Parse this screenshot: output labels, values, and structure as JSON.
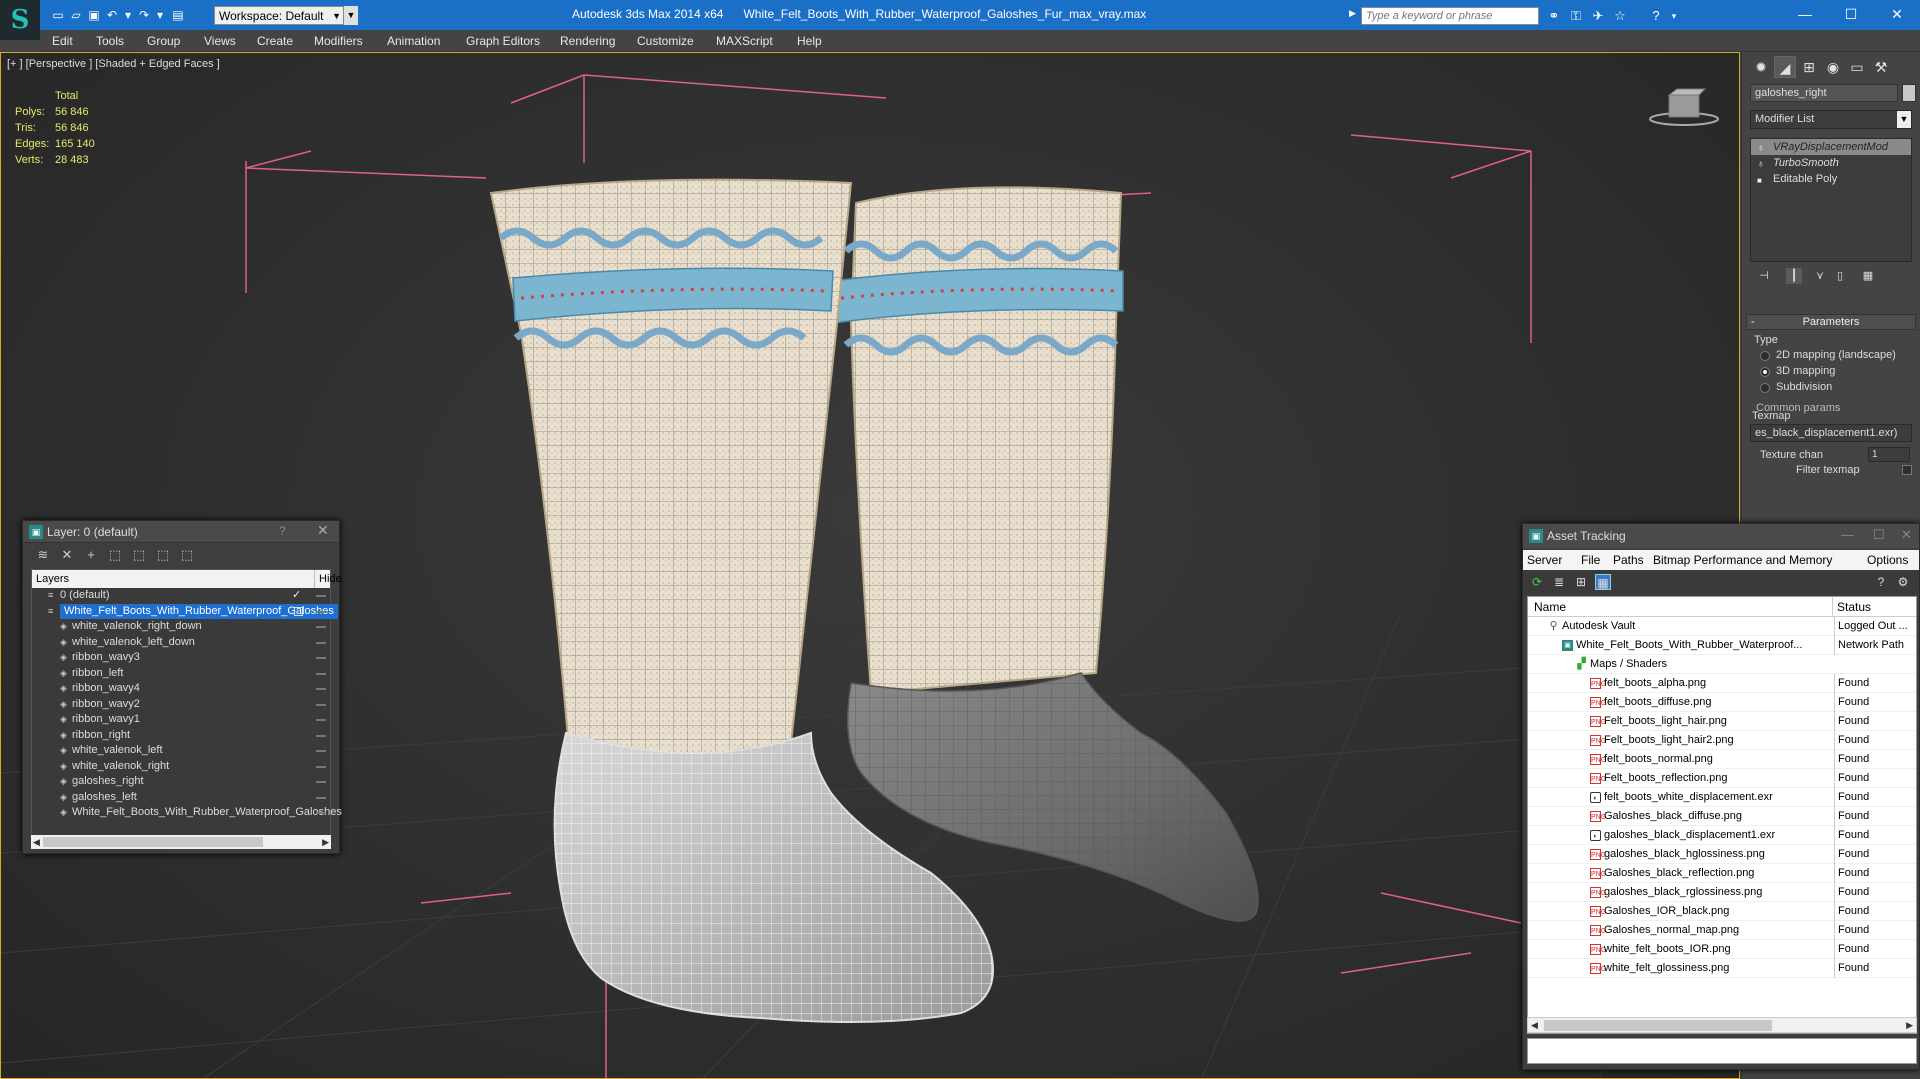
{
  "titlebar": {
    "workspace": "Workspace: Default",
    "app_name": "Autodesk 3ds Max  2014 x64",
    "file_name": "White_Felt_Boots_With_Rubber_Waterproof_Galoshes_Fur_max_vray.max",
    "search_placeholder": "Type a keyword or phrase",
    "accent_color": "#1a6fc7"
  },
  "menu": [
    "Edit",
    "Tools",
    "Group",
    "Views",
    "Create",
    "Modifiers",
    "Animation",
    "Graph Editors",
    "Rendering",
    "Customize",
    "MAXScript",
    "Help"
  ],
  "viewport": {
    "label": "[+ ] [Perspective ] [Shaded + Edged Faces ]",
    "stats": {
      "header": "Total",
      "rows": [
        {
          "k": "Polys:",
          "v": "56 846"
        },
        {
          "k": "Tris:",
          "v": "56 846"
        },
        {
          "k": "Edges:",
          "v": "165 140"
        },
        {
          "k": "Verts:",
          "v": "28 483"
        }
      ]
    },
    "border_color": "#d8a829"
  },
  "command_panel": {
    "object_name": "galoshes_right",
    "modifier_list": "Modifier List",
    "stack": [
      {
        "label": "VRayDisplacementMod",
        "selected": true
      },
      {
        "label": "TurboSmooth",
        "selected": false
      },
      {
        "label": "Editable Poly",
        "selected": false
      }
    ],
    "params_title": "Parameters",
    "type_label": "Type",
    "type_options": [
      "2D mapping (landscape)",
      "3D mapping",
      "Subdivision"
    ],
    "type_selected": 1,
    "common_params": "Common params",
    "texmap_label": "Texmap",
    "texmap_value": "es_black_displacement1.exr)",
    "texture_chan_label": "Texture chan",
    "texture_chan_value": "1",
    "filter_texmap_label": "Filter texmap"
  },
  "layer_explorer": {
    "title": "Layer: 0 (default)",
    "help": "?",
    "col_layers": "Layers",
    "col_hide": "Hide",
    "rows": [
      {
        "label": "0 (default)",
        "indent": 1,
        "type": "layer",
        "checked": true
      },
      {
        "label": "White_Felt_Boots_With_Rubber_Waterproof_Galoshes",
        "indent": 1,
        "type": "layer",
        "selected": true
      },
      {
        "label": "white_valenok_right_down",
        "indent": 2,
        "type": "obj"
      },
      {
        "label": "white_valenok_left_down",
        "indent": 2,
        "type": "obj"
      },
      {
        "label": "ribbon_wavy3",
        "indent": 2,
        "type": "obj"
      },
      {
        "label": "ribbon_left",
        "indent": 2,
        "type": "obj"
      },
      {
        "label": "ribbon_wavy4",
        "indent": 2,
        "type": "obj"
      },
      {
        "label": "ribbon_wavy2",
        "indent": 2,
        "type": "obj"
      },
      {
        "label": "ribbon_wavy1",
        "indent": 2,
        "type": "obj"
      },
      {
        "label": "ribbon_right",
        "indent": 2,
        "type": "obj"
      },
      {
        "label": "white_valenok_left",
        "indent": 2,
        "type": "obj"
      },
      {
        "label": "white_valenok_right",
        "indent": 2,
        "type": "obj"
      },
      {
        "label": "galoshes_right",
        "indent": 2,
        "type": "obj"
      },
      {
        "label": "galoshes_left",
        "indent": 2,
        "type": "obj"
      },
      {
        "label": "White_Felt_Boots_With_Rubber_Waterproof_Galoshes",
        "indent": 2,
        "type": "obj"
      }
    ]
  },
  "asset_tracking": {
    "title": "Asset Tracking",
    "menu": [
      "Server",
      "File",
      "Paths",
      "Bitmap Performance and Memory",
      "Options"
    ],
    "col_name": "Name",
    "col_status": "Status",
    "rows": [
      {
        "name": "Autodesk Vault",
        "status": "Logged Out ...",
        "icon": "vault",
        "indent": 1
      },
      {
        "name": "White_Felt_Boots_With_Rubber_Waterproof...",
        "status": "Network Path",
        "icon": "max",
        "indent": 2
      },
      {
        "name": "Maps / Shaders",
        "status": "",
        "icon": "maps",
        "indent": 3
      },
      {
        "name": "felt_boots_alpha.png",
        "status": "Found",
        "icon": "png",
        "indent": 4
      },
      {
        "name": "felt_boots_diffuse.png",
        "status": "Found",
        "icon": "png",
        "indent": 4
      },
      {
        "name": "Felt_boots_light_hair.png",
        "status": "Found",
        "icon": "png",
        "indent": 4
      },
      {
        "name": "Felt_boots_light_hair2.png",
        "status": "Found",
        "icon": "png",
        "indent": 4
      },
      {
        "name": "felt_boots_normal.png",
        "status": "Found",
        "icon": "png",
        "indent": 4
      },
      {
        "name": "Felt_boots_reflection.png",
        "status": "Found",
        "icon": "png",
        "indent": 4
      },
      {
        "name": "felt_boots_white_displacement.exr",
        "status": "Found",
        "icon": "exr",
        "indent": 4
      },
      {
        "name": "Galoshes_black_diffuse.png",
        "status": "Found",
        "icon": "png",
        "indent": 4
      },
      {
        "name": "galoshes_black_displacement1.exr",
        "status": "Found",
        "icon": "exr",
        "indent": 4
      },
      {
        "name": "galoshes_black_hglossiness.png",
        "status": "Found",
        "icon": "png",
        "indent": 4
      },
      {
        "name": "Galoshes_black_reflection.png",
        "status": "Found",
        "icon": "png",
        "indent": 4
      },
      {
        "name": "galoshes_black_rglossiness.png",
        "status": "Found",
        "icon": "png",
        "indent": 4
      },
      {
        "name": "Galoshes_IOR_black.png",
        "status": "Found",
        "icon": "png",
        "indent": 4
      },
      {
        "name": "Galoshes_normal_map.png",
        "status": "Found",
        "icon": "png",
        "indent": 4
      },
      {
        "name": "white_felt_boots_IOR.png",
        "status": "Found",
        "icon": "png",
        "indent": 4
      },
      {
        "name": "white_felt_glossiness.png",
        "status": "Found",
        "icon": "png",
        "indent": 4
      }
    ]
  }
}
